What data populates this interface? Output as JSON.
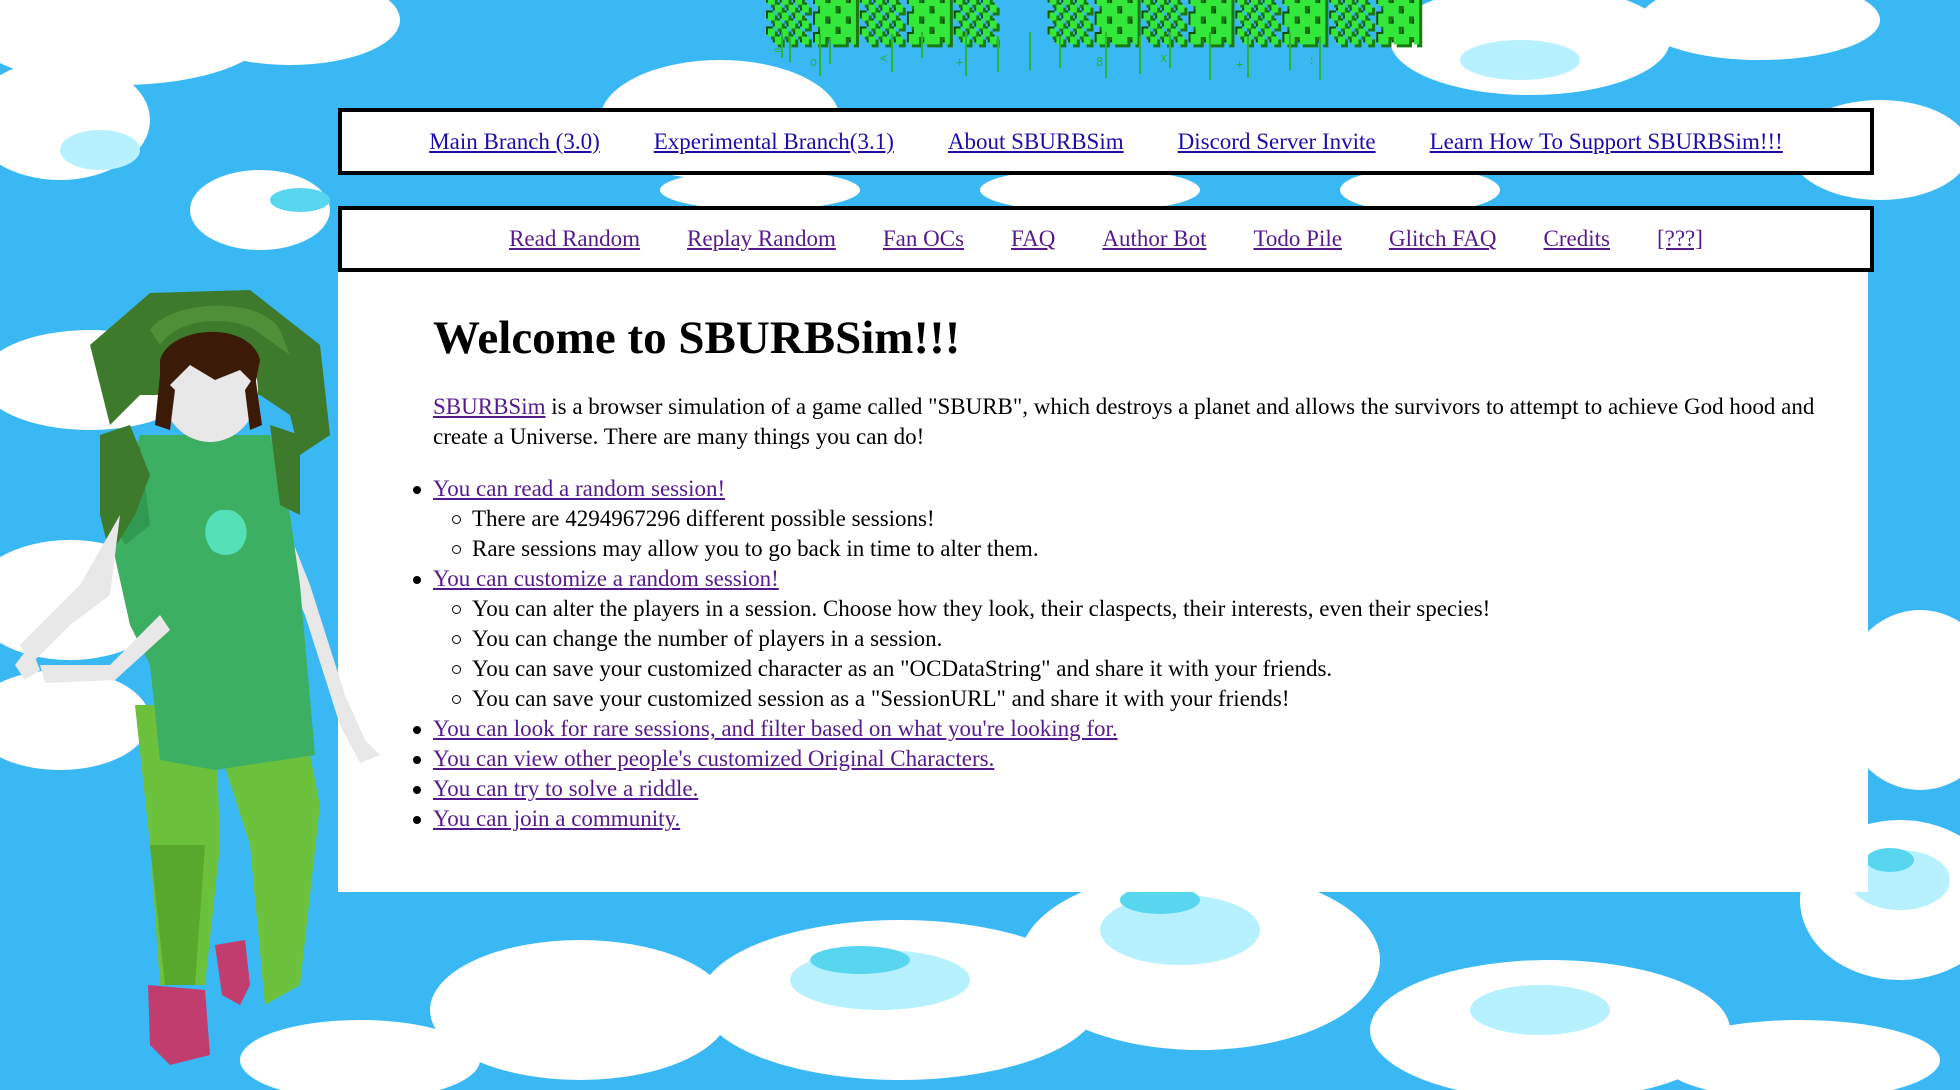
{
  "nav_primary": [
    {
      "label": "Main Branch (3.0)"
    },
    {
      "label": "Experimental Branch(3.1)"
    },
    {
      "label": "About SBURBSim"
    },
    {
      "label": "Discord Server Invite"
    },
    {
      "label": "Learn How To Support SBURBSim!!!"
    }
  ],
  "nav_secondary": [
    {
      "label": "Read Random"
    },
    {
      "label": "Replay Random"
    },
    {
      "label": "Fan OCs"
    },
    {
      "label": "FAQ"
    },
    {
      "label": "Author Bot"
    },
    {
      "label": "Todo Pile"
    },
    {
      "label": "Glitch FAQ"
    },
    {
      "label": "Credits"
    },
    {
      "label": "[???]"
    }
  ],
  "main": {
    "heading": "Welcome to SBURBSim!!!",
    "intro_link": "SBURBSim",
    "intro_text": " is a browser simulation of a game called \"SBURB\", which destroys a planet and allows the survivors to attempt to achieve God hood and create a Universe. There are many things you can do!",
    "items": [
      {
        "link": "You can read a random session!",
        "sub": [
          "There are 4294967296 different possible sessions!",
          "Rare sessions may allow you to go back in time to alter them."
        ]
      },
      {
        "link": "You can customize a random session!",
        "sub": [
          "You can alter the players in a session. Choose how they look, their claspects, their interests, even their species!",
          "You can change the number of players in a session.",
          "You can save your customized character as an \"OCDataString\" and share it with your friends.",
          "You can save your customized session as a \"SessionURL\" and share it with your friends!"
        ]
      },
      {
        "link": "You can look for rare sessions, and filter based on what you're looking for.",
        "sub": []
      },
      {
        "link": "You can view other people's customized Original Characters.",
        "sub": []
      },
      {
        "link": "You can try to solve a riddle.",
        "sub": []
      },
      {
        "link": "You can join a community.",
        "sub": []
      }
    ]
  },
  "colors": {
    "sky": "#3ab8f4",
    "link_unvisited": "#1a0dab",
    "link_visited": "#551a8b",
    "logo_green": "#33e83a"
  }
}
